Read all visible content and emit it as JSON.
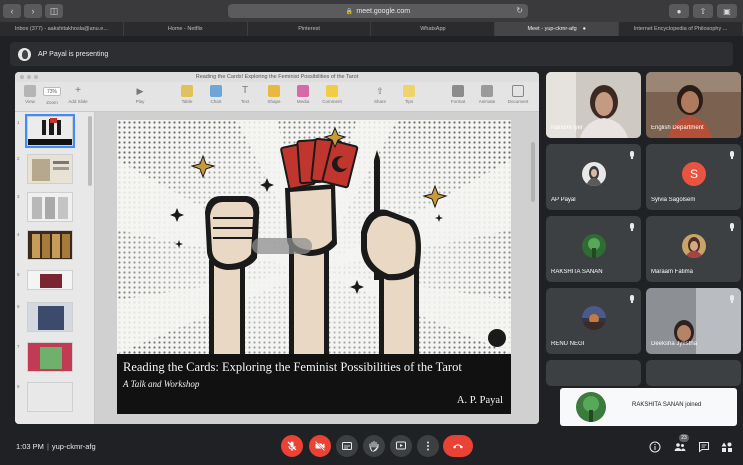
{
  "browser": {
    "url": "meet.google.com",
    "tabs": [
      {
        "label": "Inbox (377) - aakshitakhosla@anu.e...",
        "active": false
      },
      {
        "label": "Home - Netflix",
        "active": false
      },
      {
        "label": "Pinterest",
        "active": false
      },
      {
        "label": "WhatsApp",
        "active": false
      },
      {
        "label": "Meet - yup-ckmr-afg",
        "active": true
      },
      {
        "label": "Internet Encyclopedia of Philosophy ...",
        "active": false
      }
    ]
  },
  "banner": {
    "text": "AP Payal is presenting"
  },
  "keynote": {
    "window_title": "Reading the Cards! Exploring the Feminist Possibilities of the Tarot",
    "zoom": "73%",
    "toolbar": [
      {
        "label": "View"
      },
      {
        "label": "Zoom"
      },
      {
        "label": "Add Slide"
      },
      {
        "label": "Play"
      },
      {
        "label": "Table"
      },
      {
        "label": "Chart"
      },
      {
        "label": "Text"
      },
      {
        "label": "Shape"
      },
      {
        "label": "Media"
      },
      {
        "label": "Comment"
      },
      {
        "label": "Share"
      },
      {
        "label": "Tips"
      },
      {
        "label": "Format"
      },
      {
        "label": "Animate"
      },
      {
        "label": "Document"
      }
    ],
    "slide": {
      "title": "Reading the Cards: Exploring the Feminist Possibilities of the Tarot",
      "subtitle": "A Talk and Workshop",
      "author": "A. P. Payal"
    }
  },
  "participants": [
    {
      "name": "Nandini Iyer",
      "kind": "video",
      "mic": false
    },
    {
      "name": "English Department",
      "kind": "video",
      "mic": false
    },
    {
      "name": "AP Payal",
      "kind": "avatar",
      "mic": true
    },
    {
      "name": "Sylvia Sagolsem",
      "kind": "letter",
      "letter": "S",
      "mic": true
    },
    {
      "name": "RAKSHITA SANAN",
      "kind": "avatar",
      "mic": true
    },
    {
      "name": "Maraam Fatima",
      "kind": "avatar",
      "mic": true
    },
    {
      "name": "RENU NEGI",
      "kind": "avatar",
      "mic": true
    },
    {
      "name": "Deeksha Jyestha",
      "kind": "video",
      "mic": true
    }
  ],
  "toast": {
    "text": "RAKSHITA SANAN joined"
  },
  "bottom": {
    "time": "1:03 PM",
    "meeting_code": "yup-ckmr-afg",
    "people_count": "23"
  },
  "colors": {
    "meet_bg": "#202124",
    "tile_bg": "#3c4043",
    "end_call": "#ea4335",
    "accent_s": "#e8543f"
  }
}
